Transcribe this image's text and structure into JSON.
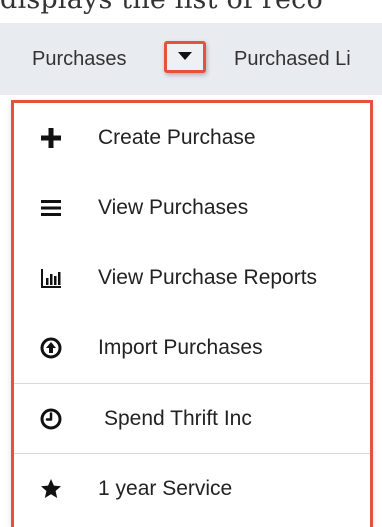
{
  "context_text": "displays the list of reco",
  "nav": {
    "items": [
      {
        "label": "Purchases"
      },
      {
        "label": "Purchased Li"
      }
    ],
    "caret_icon": "caret-down-icon"
  },
  "menu": {
    "highlight_color": "#e4513c",
    "items": [
      {
        "label": "Create Purchase",
        "icon": "plus-icon"
      },
      {
        "label": "View Purchases",
        "icon": "list-icon"
      },
      {
        "label": "View Purchase Reports",
        "icon": "bar-chart-icon"
      },
      {
        "label": "Import Purchases",
        "icon": "upload-icon"
      },
      {
        "label": "Spend Thrift Inc",
        "icon": "clock-icon"
      },
      {
        "label": "1 year Service",
        "icon": "star-icon"
      }
    ]
  }
}
